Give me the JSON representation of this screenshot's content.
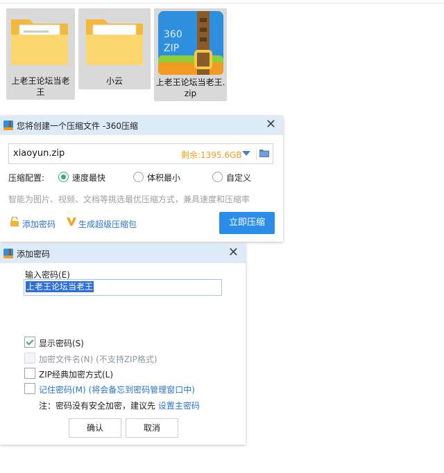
{
  "desktop": {
    "items": [
      {
        "label": "上老王论坛当老王"
      },
      {
        "label": "小云"
      },
      {
        "label": "上老王论坛当老王.zip"
      }
    ]
  },
  "compress_dialog": {
    "title": "您将创建一个压缩文件 -360压缩",
    "filename": "xiaoyun.zip",
    "free_space": "剩余:1395.6GB",
    "config_label": "压缩配置:",
    "options": [
      "速度最快",
      "体积最小",
      "自定义"
    ],
    "selected_option": "速度最快",
    "hint": "智能为图片、视频、文档等挑选最优压缩方式，兼具速度和压缩率",
    "add_password": "添加密码",
    "super_package": "生成超级压缩包",
    "compress_button": "立即压缩"
  },
  "password_dialog": {
    "title": "添加密码",
    "input_label": "输入密码(E)",
    "password_value": "上老王论坛当老王",
    "checkboxes": [
      {
        "label": "显示密码(S)",
        "checked": true,
        "disabled": false
      },
      {
        "label": "加密文件名(N) (不支持ZIP格式)",
        "checked": false,
        "disabled": true
      },
      {
        "label": "ZIP经典加密方式(L)",
        "checked": false,
        "disabled": false
      },
      {
        "label": "记住密码(M) (将会备忘到密码管理窗口中)",
        "checked": false,
        "disabled": false
      }
    ],
    "note_prefix": "注：密码没有安全加密，建议先",
    "note_link": "设置主密码",
    "ok_button": "确认",
    "cancel_button": "取消"
  },
  "colors": {
    "accent_blue": "#2a8ee8",
    "link_blue": "#2a74c9",
    "check_green": "#2fb06a",
    "free_space_orange": "#e8a020"
  }
}
